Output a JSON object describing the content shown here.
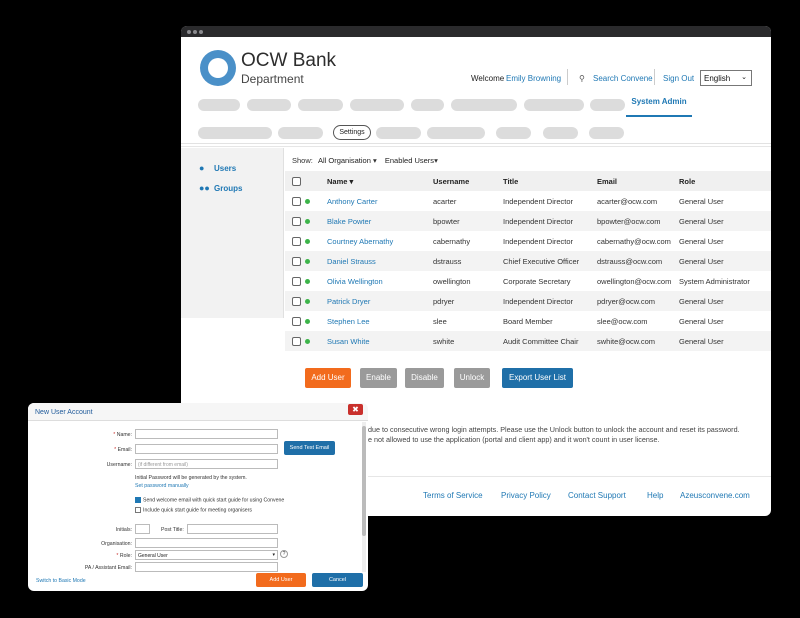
{
  "brand": {
    "name": "OCW Bank",
    "sub": "Department"
  },
  "header": {
    "welcome": "Welcome",
    "user": "Emily Browning",
    "search": "Search Convene",
    "signout": "Sign Out",
    "language": "English"
  },
  "nav": {
    "active": "System Admin"
  },
  "subnav": {
    "settings": "Settings"
  },
  "sidebar": {
    "items": [
      {
        "label": "Users",
        "icon": "user-icon"
      },
      {
        "label": "Groups",
        "icon": "group-icon"
      }
    ]
  },
  "filter": {
    "show_label": "Show:",
    "org": "All Organisation",
    "status": "Enabled Users"
  },
  "table": {
    "headers": [
      "Name",
      "Username",
      "Title",
      "Email",
      "Role"
    ],
    "rows": [
      [
        "Anthony Carter",
        "acarter",
        "Independent Director",
        "acarter@ocw.com",
        "General User"
      ],
      [
        "Blake Powter",
        "bpowter",
        "Independent Director",
        "bpowter@ocw.com",
        "General User"
      ],
      [
        "Courtney Abernathy",
        "cabernathy",
        "Independent Director",
        "cabernathy@ocw.com",
        "General User"
      ],
      [
        "Daniel Strauss",
        "dstrauss",
        "Chief Executive Officer",
        "dstrauss@ocw.com",
        "General User"
      ],
      [
        "Olivia Wellington",
        "owellington",
        "Corporate Secretary",
        "owellington@ocw.com",
        "System Administrator"
      ],
      [
        "Patrick Dryer",
        "pdryer",
        "Independent Director",
        "pdryer@ocw.com",
        "General User"
      ],
      [
        "Stephen Lee",
        "slee",
        "Board Member",
        "slee@ocw.com",
        "General User"
      ],
      [
        "Susan White",
        "swhite",
        "Audit Committee Chair",
        "swhite@ocw.com",
        "General User"
      ]
    ]
  },
  "actions": {
    "add": "Add User",
    "enable": "Enable",
    "disable": "Disable",
    "unlock": "Unlock",
    "export": "Export User List"
  },
  "notes": {
    "line1": "due to consecutive wrong login attempts. Please use the Unlock button to unlock the account and reset its password.",
    "line2": "e not allowed to use the application (portal and client app) and it won't count in user license."
  },
  "footer": {
    "terms": "Terms of Service",
    "privacy": "Privacy Policy",
    "support": "Contact Support",
    "help": "Help",
    "site": "Azeusconvene.com"
  },
  "dialog": {
    "title": "New User Account",
    "close": "✖",
    "name_label": "Name:",
    "email_label": "Email:",
    "username_label": "Username:",
    "username_placeholder": "(if different from email)",
    "send_test": "Send Test Email",
    "pw_note": "Initial Password will be generated by the system.",
    "pw_link": "Set password manually",
    "opt1": "Send welcome email with quick start guide for using Convene",
    "opt2": "Include quick start guide for meeting organisers",
    "initials_label": "Initials:",
    "post_title_label": "Post Title:",
    "org_label": "Organisation:",
    "role_label": "Role:",
    "role_value": "General User",
    "pa_label": "PA / Assistant Email:",
    "switch": "Switch to Basic Mode",
    "add": "Add User",
    "cancel": "Cancel"
  },
  "colors": {
    "accent": "#1f78b4",
    "add": "#f26b1d",
    "gray_btn": "#9a9a9a",
    "export": "#1f6fa8",
    "status": "#3cb449"
  }
}
